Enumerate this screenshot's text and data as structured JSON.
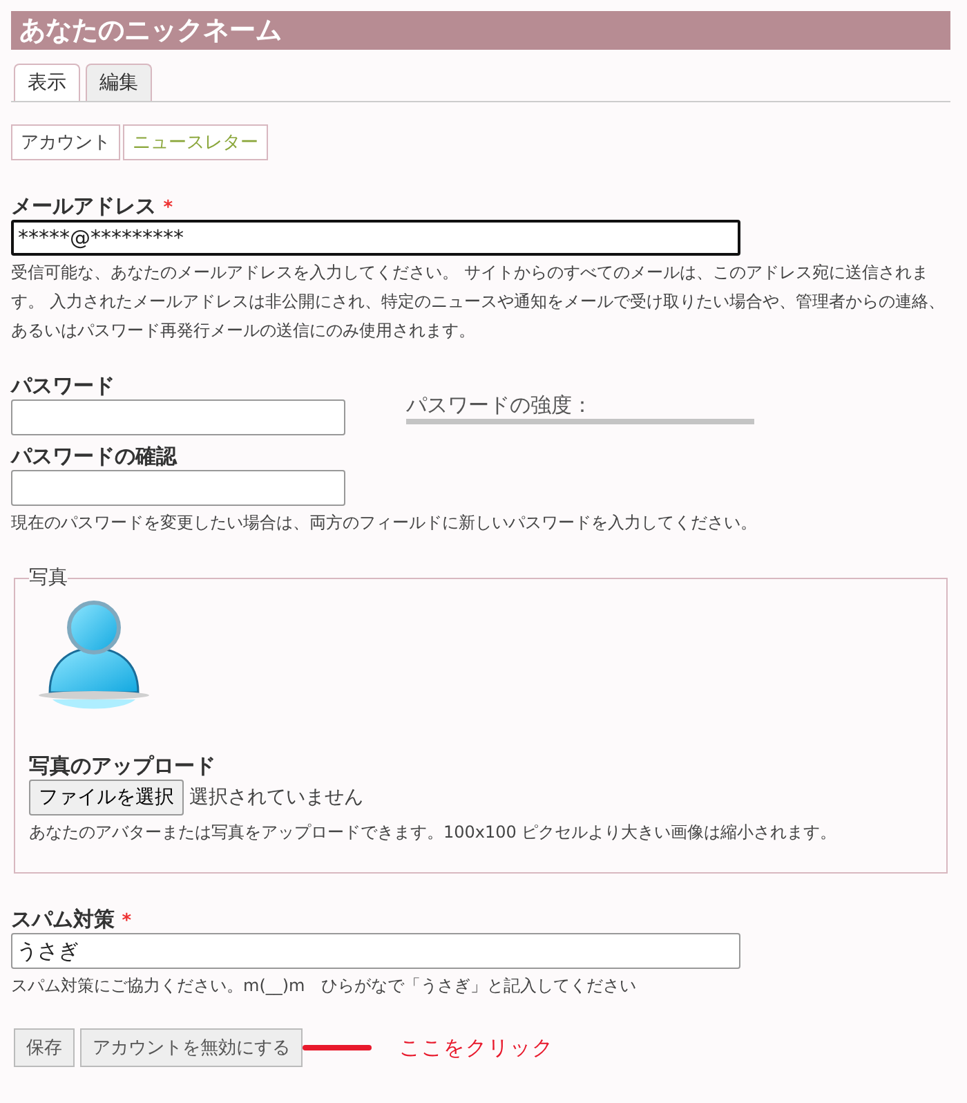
{
  "page_title": "あなたのニックネーム",
  "tabs": [
    {
      "label": "表示",
      "selected": true
    },
    {
      "label": "編集",
      "selected": false
    }
  ],
  "subtabs": [
    {
      "label": "アカウント",
      "selected": true
    },
    {
      "label": "ニュースレター",
      "selected": false
    }
  ],
  "email": {
    "label": "メールアドレス",
    "required_mark": "*",
    "value": "*****@*********",
    "description": "受信可能な、あなたのメールアドレスを入力してください。 サイトからのすべてのメールは、このアドレス宛に送信されます。 入力されたメールアドレスは非公開にされ、特定のニュースや通知をメールで受け取りたい場合や、管理者からの連絡、あるいはパスワード再発行メールの送信にのみ使用されます。"
  },
  "password": {
    "label": "パスワード",
    "strength_label": "パスワードの強度：",
    "level": 0
  },
  "password_confirm": {
    "label": "パスワードの確認",
    "description": "現在のパスワードを変更したい場合は、両方のフィールドに新しいパスワードを入力してください。"
  },
  "photo": {
    "legend": "写真",
    "upload_label": "写真のアップロード",
    "file_button": "ファイルを選択",
    "file_status": "選択されていません",
    "description": "あなたのアバターまたは写真をアップロードできます。100x100 ピクセルより大きい画像は縮小されます。"
  },
  "spam": {
    "label": "スパム対策",
    "required_mark": "*",
    "value": "うさぎ",
    "description": "スパム対策にご協力ください。m(__)m　ひらがなで「うさぎ」と記入してください"
  },
  "buttons": [
    "保存",
    "アカウントを無効にする"
  ],
  "annotation": {
    "text": "ここをクリック"
  }
}
